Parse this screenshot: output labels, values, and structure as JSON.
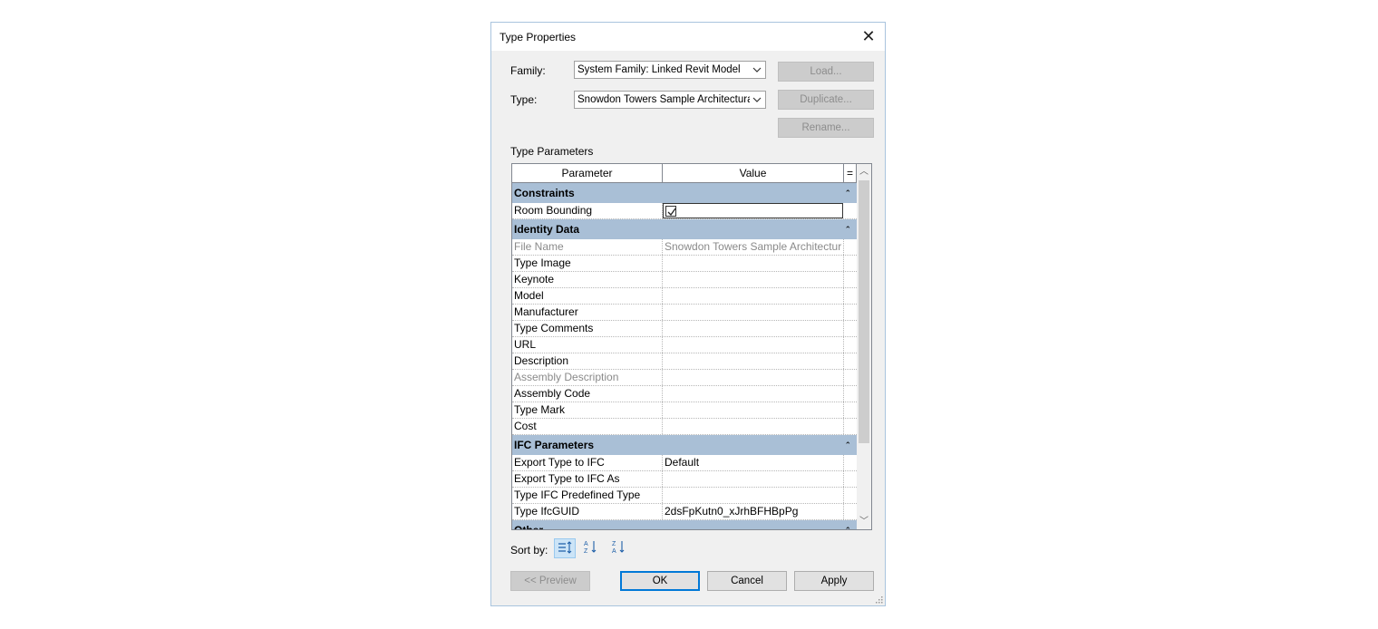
{
  "window": {
    "title": "Type Properties"
  },
  "family": {
    "label": "Family:",
    "value": "System Family: Linked Revit Model"
  },
  "type": {
    "label": "Type:",
    "value": "Snowdon Towers Sample Architectural.r"
  },
  "buttons": {
    "load": "Load...",
    "duplicate": "Duplicate...",
    "rename": "Rename...",
    "preview": "<< Preview",
    "ok": "OK",
    "cancel": "Cancel",
    "apply": "Apply"
  },
  "type_parameters_label": "Type Parameters",
  "table": {
    "col_parameter": "Parameter",
    "col_value": "Value",
    "col_extra": "=",
    "groups": [
      {
        "name": "Constraints",
        "rows": [
          {
            "param": "Room Bounding",
            "value": "",
            "checkbox": true
          }
        ]
      },
      {
        "name": "Identity Data",
        "rows": [
          {
            "param": "File Name",
            "value": "Snowdon Towers Sample Architectur",
            "gray": true
          },
          {
            "param": "Type Image",
            "value": ""
          },
          {
            "param": "Keynote",
            "value": ""
          },
          {
            "param": "Model",
            "value": ""
          },
          {
            "param": "Manufacturer",
            "value": ""
          },
          {
            "param": "Type Comments",
            "value": ""
          },
          {
            "param": "URL",
            "value": ""
          },
          {
            "param": "Description",
            "value": ""
          },
          {
            "param": "Assembly Description",
            "value": "",
            "gray": true
          },
          {
            "param": "Assembly Code",
            "value": ""
          },
          {
            "param": "Type Mark",
            "value": ""
          },
          {
            "param": "Cost",
            "value": ""
          }
        ]
      },
      {
        "name": "IFC Parameters",
        "rows": [
          {
            "param": "Export Type to IFC",
            "value": "Default"
          },
          {
            "param": "Export Type to IFC As",
            "value": ""
          },
          {
            "param": "Type IFC Predefined Type",
            "value": ""
          },
          {
            "param": "Type IfcGUID",
            "value": "2dsFpKutn0_xJrhBFHBpPg"
          }
        ]
      },
      {
        "name": "Other",
        "rows": []
      }
    ]
  },
  "sort": {
    "label": "Sort by:"
  },
  "icons": {
    "close": "close-icon",
    "collapse": "collapse-chevron-icon",
    "dropdown": "chevron-down-icon"
  },
  "colors": {
    "group_header": "#a9bfd6",
    "default_button_border": "#0078d7",
    "dialog_border": "#a9c4de"
  }
}
